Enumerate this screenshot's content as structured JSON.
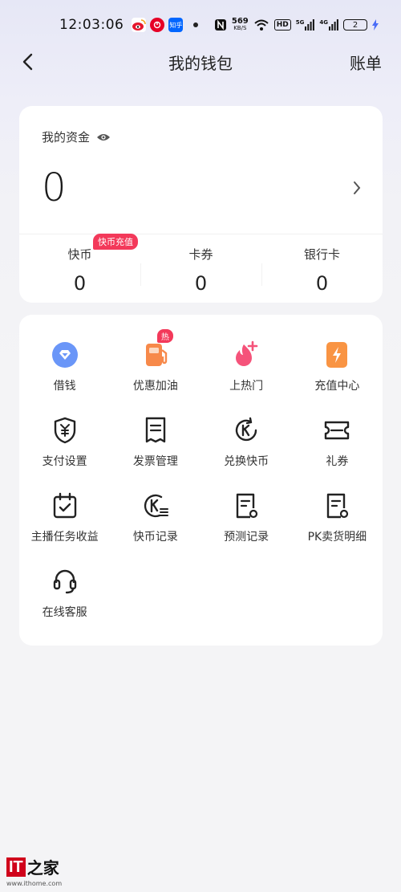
{
  "status_bar": {
    "time": "12:03:06",
    "notifications": [
      {
        "name": "weibo-icon",
        "color": "#f5a623"
      },
      {
        "name": "netease-music-icon",
        "color": "#e60026"
      },
      {
        "name": "zhihu-icon",
        "color": "#0066ff",
        "text": "知乎"
      }
    ],
    "net_speed": "569",
    "net_unit": "KB/S",
    "hd_label": "HD",
    "sig1": "5G",
    "sig2": "4G",
    "battery": "2"
  },
  "nav": {
    "back_icon": "back-arrow-icon",
    "title": "我的钱包",
    "right": "账单"
  },
  "funds": {
    "label": "我的资金",
    "eye_icon": "eye-icon",
    "balance": "0",
    "stats": [
      {
        "label": "快币",
        "value": "0",
        "badge": "快币充值"
      },
      {
        "label": "卡券",
        "value": "0"
      },
      {
        "label": "银行卡",
        "value": "0"
      }
    ]
  },
  "services": [
    {
      "label": "借钱",
      "icon": "loan-icon"
    },
    {
      "label": "优惠加油",
      "icon": "fuel-icon",
      "badge": "热"
    },
    {
      "label": "上热门",
      "icon": "flame-plus-icon"
    },
    {
      "label": "充值中心",
      "icon": "recharge-icon"
    },
    {
      "label": "支付设置",
      "icon": "payment-shield-icon"
    },
    {
      "label": "发票管理",
      "icon": "invoice-icon"
    },
    {
      "label": "兑换快币",
      "icon": "exchange-coin-icon"
    },
    {
      "label": "礼券",
      "icon": "ticket-icon"
    },
    {
      "label": "主播任务收益",
      "icon": "calendar-check-icon"
    },
    {
      "label": "快币记录",
      "icon": "coin-record-icon"
    },
    {
      "label": "预测记录",
      "icon": "prediction-record-icon"
    },
    {
      "label": "PK卖货明细",
      "icon": "pk-sales-icon"
    },
    {
      "label": "在线客服",
      "icon": "headset-icon"
    }
  ],
  "watermark": {
    "logo_it": "IT",
    "logo_cn": "之家",
    "url": "www.ithome.com"
  },
  "colors": {
    "accent_red": "#f3395a",
    "loan_blue": "#5b8ff9",
    "fuel_orange": "#f7894a",
    "flame_pink": "#f5537a",
    "recharge_orange": "#f99443"
  }
}
